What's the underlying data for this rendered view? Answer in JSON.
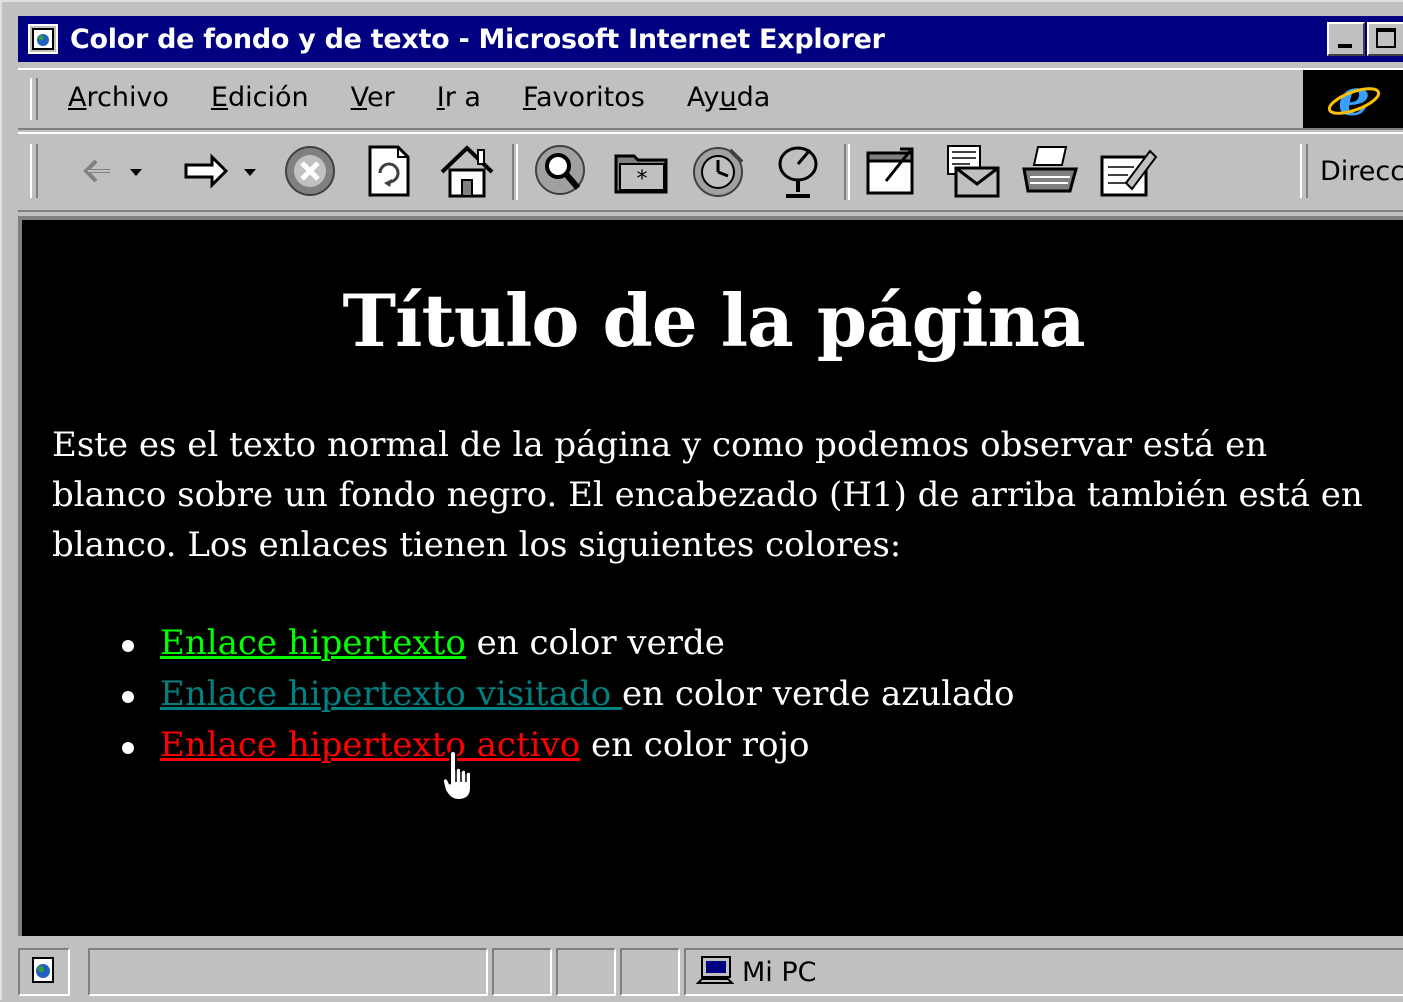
{
  "window": {
    "title": "Color de fondo y de texto - Microsoft Internet Explorer"
  },
  "menu": {
    "items": [
      {
        "before": "",
        "accel": "A",
        "after": "rchivo"
      },
      {
        "before": "",
        "accel": "E",
        "after": "dición"
      },
      {
        "before": "",
        "accel": "V",
        "after": "er"
      },
      {
        "before": "",
        "accel": "I",
        "after": "r a"
      },
      {
        "before": "",
        "accel": "F",
        "after": "avoritos"
      },
      {
        "before": "Ay",
        "accel": "u",
        "after": "da"
      }
    ]
  },
  "toolbar": {
    "buttons": [
      "back-icon",
      "forward-icon",
      "stop-icon",
      "refresh-icon",
      "home-icon",
      "search-icon",
      "favorites-icon",
      "history-icon",
      "channels-icon",
      "fullscreen-icon",
      "mail-icon",
      "print-icon",
      "edit-icon"
    ],
    "address_label": "Direcci"
  },
  "page": {
    "heading": "Título de la página",
    "paragraph": "Este es el texto normal de la página y como podemos observar está en blanco sobre un fondo negro. El encabezado (H1) de arriba también está en blanco. Los enlaces tienen los siguientes colores:",
    "items": [
      {
        "link": "Enlace hipertexto",
        "rest": " en color verde",
        "color": "#00ff00"
      },
      {
        "link": "Enlace hipertexto visitado ",
        "rest": "en color verde azulado",
        "color": "#008080"
      },
      {
        "link": "Enlace hipertexto activo",
        "rest": " en color rojo",
        "color": "#ff0000"
      }
    ]
  },
  "status": {
    "zone": "Mi PC"
  },
  "colors": {
    "title_bar": "#000080",
    "chrome": "#c0c0c0",
    "page_background": "#000000",
    "text": "#ffffff"
  }
}
